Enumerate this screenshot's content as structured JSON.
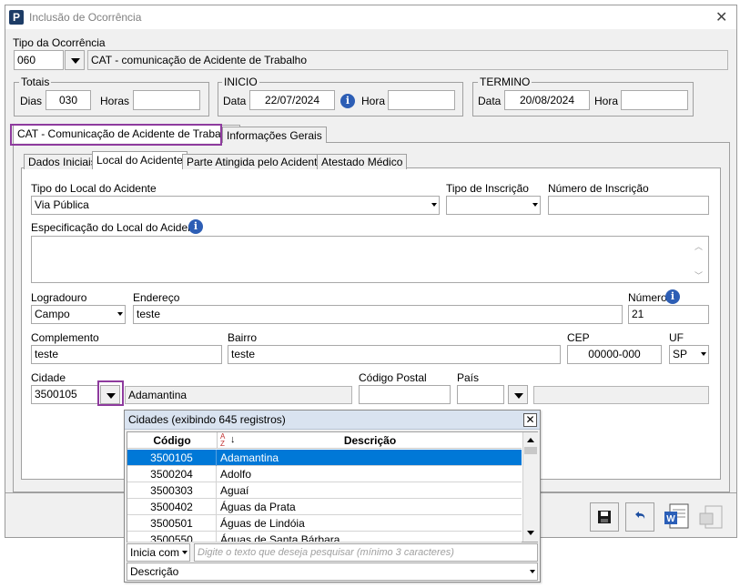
{
  "window": {
    "title": "Inclusão de Ocorrência",
    "app_icon_letter": "P",
    "close_glyph": "✕"
  },
  "tipo_ocorrencia": {
    "label": "Tipo da Ocorrência",
    "code": "060",
    "description": "CAT - comunicação de Acidente de Trabalho"
  },
  "totais": {
    "legend": "Totais",
    "dias_label": "Dias",
    "dias_value": "030",
    "horas_label": "Horas",
    "horas_value": ""
  },
  "inicio": {
    "legend": "INICIO",
    "data_label": "Data",
    "data_value": "22/07/2024",
    "hora_label": "Hora",
    "hora_value": ""
  },
  "termino": {
    "legend": "TERMINO",
    "data_label": "Data",
    "data_value": "20/08/2024",
    "hora_label": "Hora",
    "hora_value": ""
  },
  "outer_tabs": [
    "CAT - Comunicação de Acidente de Trabalho",
    "Informações Gerais"
  ],
  "inner_tabs": [
    "Dados Iniciais",
    "Local do Acidente",
    "Parte Atingida pelo Acidente",
    "Atestado Médico"
  ],
  "form": {
    "tipo_local_label": "Tipo do Local do Acidente",
    "tipo_local_value": "Via Pública",
    "tipo_inscricao_label": "Tipo de Inscrição",
    "tipo_inscricao_value": "",
    "numero_inscricao_label": "Número de Inscrição",
    "numero_inscricao_value": "",
    "especificacao_label": "Especificação do Local do Acidente",
    "especificacao_value": "",
    "logradouro_label": "Logradouro",
    "logradouro_value": "Campo",
    "endereco_label": "Endereço",
    "endereco_value": "teste",
    "numero_label": "Número",
    "numero_value": "21",
    "complemento_label": "Complemento",
    "complemento_value": "teste",
    "bairro_label": "Bairro",
    "bairro_value": "teste",
    "cep_label": "CEP",
    "cep_value": "00000-000",
    "uf_label": "UF",
    "uf_value": "SP",
    "cidade_label": "Cidade",
    "cidade_code": "3500105",
    "cidade_name": "Adamantina",
    "codigo_postal_label": "Código Postal",
    "codigo_postal_value": "",
    "pais_label": "País",
    "pais_code": "",
    "pais_name": ""
  },
  "lookup": {
    "title": "Cidades (exibindo 645 registros)",
    "col_codigo": "Código",
    "col_descricao": "Descrição",
    "sort_icon_text": "A Z",
    "rows": [
      {
        "codigo": "3500105",
        "descricao": "Adamantina"
      },
      {
        "codigo": "3500204",
        "descricao": "Adolfo"
      },
      {
        "codigo": "3500303",
        "descricao": "Aguaí"
      },
      {
        "codigo": "3500402",
        "descricao": "Águas da Prata"
      },
      {
        "codigo": "3500501",
        "descricao": "Águas de Lindóia"
      },
      {
        "codigo": "3500550",
        "descricao": "Águas de Santa Bárbara"
      }
    ],
    "search_mode": "Inicia com",
    "search_placeholder": "Digite o texto que deseja pesquisar (mínimo 3 caracteres)",
    "search_field": "Descrição"
  },
  "colors": {
    "highlight": "#8e3b9e",
    "selection": "#0078d7",
    "info": "#2d5eb5"
  }
}
